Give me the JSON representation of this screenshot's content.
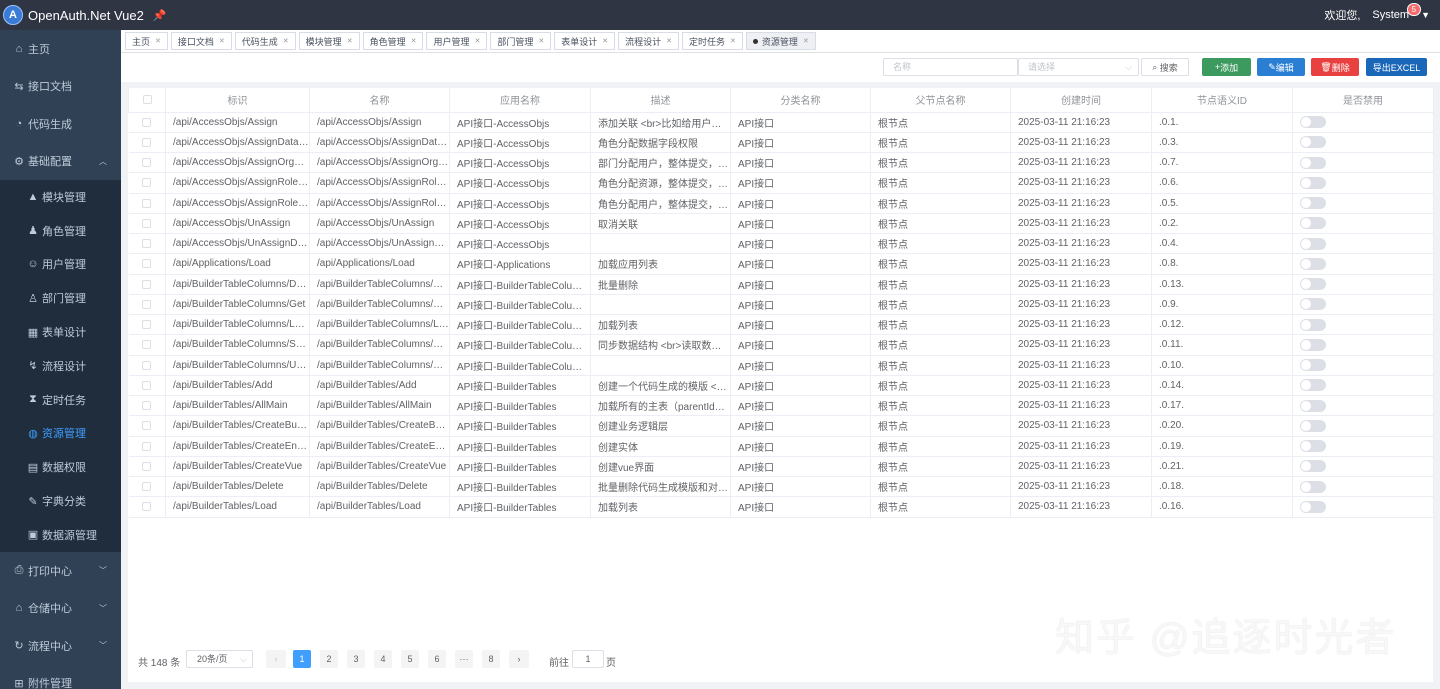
{
  "header": {
    "logo": "A",
    "title": "OpenAuth.Net Vue2",
    "pin_icon": "pin-icon",
    "welcome": "欢迎您,",
    "user": "System",
    "badge": "5"
  },
  "sidebar": {
    "items": [
      {
        "label": "主页",
        "icon": "home-icon",
        "sub": false,
        "arrow": false,
        "active": false
      },
      {
        "label": "接口文档",
        "icon": "api-icon",
        "sub": false,
        "arrow": false,
        "active": false
      },
      {
        "label": "代码生成",
        "icon": "code-icon",
        "sub": false,
        "arrow": false,
        "active": false
      },
      {
        "label": "基础配置",
        "icon": "gear-icon",
        "sub": false,
        "arrow": true,
        "open": true,
        "active": false
      },
      {
        "label": "模块管理",
        "icon": "module-icon",
        "sub": true,
        "active": false
      },
      {
        "label": "角色管理",
        "icon": "role-icon",
        "sub": true,
        "active": false
      },
      {
        "label": "用户管理",
        "icon": "user-icon",
        "sub": true,
        "active": false
      },
      {
        "label": "部门管理",
        "icon": "org-icon",
        "sub": true,
        "active": false
      },
      {
        "label": "表单设计",
        "icon": "form-icon",
        "sub": true,
        "active": false
      },
      {
        "label": "流程设计",
        "icon": "flow-icon",
        "sub": true,
        "active": false
      },
      {
        "label": "定时任务",
        "icon": "timer-icon",
        "sub": true,
        "active": false
      },
      {
        "label": "资源管理",
        "icon": "resource-icon",
        "sub": true,
        "active": true
      },
      {
        "label": "数据权限",
        "icon": "data-icon",
        "sub": true,
        "active": false
      },
      {
        "label": "字典分类",
        "icon": "dict-icon",
        "sub": true,
        "active": false
      },
      {
        "label": "数据源管理",
        "icon": "db-icon",
        "sub": true,
        "active": false
      },
      {
        "label": "打印中心",
        "icon": "print-icon",
        "sub": false,
        "arrow": true,
        "active": false
      },
      {
        "label": "仓储中心",
        "icon": "store-icon",
        "sub": false,
        "arrow": true,
        "active": false
      },
      {
        "label": "流程中心",
        "icon": "process-icon",
        "sub": false,
        "arrow": true,
        "active": false
      },
      {
        "label": "附件管理",
        "icon": "attach-icon",
        "sub": false,
        "arrow": false,
        "active": false
      }
    ]
  },
  "tags": [
    "主页",
    "接口文档",
    "代码生成",
    "模块管理",
    "角色管理",
    "用户管理",
    "部门管理",
    "表单设计",
    "流程设计",
    "定时任务",
    "资源管理"
  ],
  "active_tag": "资源管理",
  "toolbar": {
    "name_placeholder": "名称",
    "select_placeholder": "请选择",
    "search": "搜索",
    "add": "添加",
    "edit": "编辑",
    "delete": "删除",
    "export": "导出EXCEL"
  },
  "colors": {
    "add": "#3c9a5f",
    "edit": "#2a7fd4",
    "delete": "#e8413f",
    "export": "#1a67b9",
    "active_page": "#409eff"
  },
  "table": {
    "headers": [
      "标识",
      "名称",
      "应用名称",
      "描述",
      "分类名称",
      "父节点名称",
      "创建时间",
      "节点语义ID",
      "是否禁用"
    ],
    "rows": [
      [
        "/api/AccessObjs/Assign",
        "/api/AccessObjs/Assign",
        "API接口-AccessObjs",
        "添加关联 <br>比如给用户分配资源",
        "API接口",
        "根节点",
        "2025-03-11 21:16:23",
        ".0.1."
      ],
      [
        "/api/AccessObjs/AssignDataProperty",
        "/api/AccessObjs/AssignDataProperty",
        "API接口-AccessObjs",
        "角色分配数据字段权限",
        "API接口",
        "根节点",
        "2025-03-11 21:16:23",
        ".0.3."
      ],
      [
        "/api/AccessObjs/AssignOrgUsers",
        "/api/AccessObjs/AssignOrgUsers",
        "API接口-AccessObjs",
        "部门分配用户，整体提交，会覆盖之前的配置",
        "API接口",
        "根节点",
        "2025-03-11 21:16:23",
        ".0.7."
      ],
      [
        "/api/AccessObjs/AssignRoleResources",
        "/api/AccessObjs/AssignRoleResources",
        "API接口-AccessObjs",
        "角色分配资源，整体提交，会覆盖之前的配置",
        "API接口",
        "根节点",
        "2025-03-11 21:16:23",
        ".0.6."
      ],
      [
        "/api/AccessObjs/AssignRoleUsers",
        "/api/AccessObjs/AssignRoleUsers",
        "API接口-AccessObjs",
        "角色分配用户，整体提交，会覆盖之前的配置",
        "API接口",
        "根节点",
        "2025-03-11 21:16:23",
        ".0.5."
      ],
      [
        "/api/AccessObjs/UnAssign",
        "/api/AccessObjs/UnAssign",
        "API接口-AccessObjs",
        "取消关联",
        "API接口",
        "根节点",
        "2025-03-11 21:16:23",
        ".0.2."
      ],
      [
        "/api/AccessObjs/UnAssignDataProperty",
        "/api/AccessObjs/UnAssignDataProperty",
        "API接口-AccessObjs",
        "",
        "API接口",
        "根节点",
        "2025-03-11 21:16:23",
        ".0.4."
      ],
      [
        "/api/Applications/Load",
        "/api/Applications/Load",
        "API接口-Applications",
        "加载应用列表",
        "API接口",
        "根节点",
        "2025-03-11 21:16:23",
        ".0.8."
      ],
      [
        "/api/BuilderTableColumns/Delete",
        "/api/BuilderTableColumns/Delete",
        "API接口-BuilderTableColumns",
        "批量删除",
        "API接口",
        "根节点",
        "2025-03-11 21:16:23",
        ".0.13."
      ],
      [
        "/api/BuilderTableColumns/Get",
        "/api/BuilderTableColumns/Get",
        "API接口-BuilderTableColumns",
        "",
        "API接口",
        "根节点",
        "2025-03-11 21:16:23",
        ".0.9."
      ],
      [
        "/api/BuilderTableColumns/Load",
        "/api/BuilderTableColumns/Load",
        "API接口-BuilderTableColumns",
        "加载列表",
        "API接口",
        "根节点",
        "2025-03-11 21:16:23",
        ".0.12."
      ],
      [
        "/api/BuilderTableColumns/Sync",
        "/api/BuilderTableColumns/Sync",
        "API接口-BuilderTableColumns",
        "同步数据结构 <br>读取数据库结构与当前结构的差异",
        "API接口",
        "根节点",
        "2025-03-11 21:16:23",
        ".0.11."
      ],
      [
        "/api/BuilderTableColumns/Update",
        "/api/BuilderTableColumns/Update",
        "API接口-BuilderTableColumns",
        "",
        "API接口",
        "根节点",
        "2025-03-11 21:16:23",
        ".0.10."
      ],
      [
        "/api/BuilderTables/Add",
        "/api/BuilderTables/Add",
        "API接口-BuilderTables",
        "创建一个代码生成的模版 <br>会自动创建字段明细信息",
        "API接口",
        "根节点",
        "2025-03-11 21:16:23",
        ".0.14."
      ],
      [
        "/api/BuilderTables/AllMain",
        "/api/BuilderTables/AllMain",
        "API接口-BuilderTables",
        "加载所有的主表（parentId为空的）",
        "API接口",
        "根节点",
        "2025-03-11 21:16:23",
        ".0.17."
      ],
      [
        "/api/BuilderTables/CreateBusiness",
        "/api/BuilderTables/CreateBusiness",
        "API接口-BuilderTables",
        "创建业务逻辑层",
        "API接口",
        "根节点",
        "2025-03-11 21:16:23",
        ".0.20."
      ],
      [
        "/api/BuilderTables/CreateEntity",
        "/api/BuilderTables/CreateEntity",
        "API接口-BuilderTables",
        "创建实体",
        "API接口",
        "根节点",
        "2025-03-11 21:16:23",
        ".0.19."
      ],
      [
        "/api/BuilderTables/CreateVue",
        "/api/BuilderTables/CreateVue",
        "API接口-BuilderTables",
        "创建vue界面",
        "API接口",
        "根节点",
        "2025-03-11 21:16:23",
        ".0.21."
      ],
      [
        "/api/BuilderTables/Delete",
        "/api/BuilderTables/Delete",
        "API接口-BuilderTables",
        "批量删除代码生成模版和对应的字段信息",
        "API接口",
        "根节点",
        "2025-03-11 21:16:23",
        ".0.18."
      ],
      [
        "/api/BuilderTables/Load",
        "/api/BuilderTables/Load",
        "API接口-BuilderTables",
        "加载列表",
        "API接口",
        "根节点",
        "2025-03-11 21:16:23",
        ".0.16."
      ]
    ]
  },
  "pager": {
    "total": "共 148 条",
    "size": "20条/页",
    "pages": [
      "1",
      "2",
      "3",
      "4",
      "5",
      "6",
      "···",
      "8"
    ],
    "current": "1",
    "goto_label": "前往",
    "goto_value": "1",
    "goto_suffix": "页",
    "prev": "‹",
    "next": "›"
  },
  "watermark": "知乎 @追逐时光者"
}
